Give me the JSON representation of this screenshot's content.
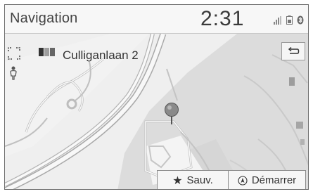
{
  "header": {
    "title": "Navigation",
    "time": "2:31",
    "status_icons": [
      "signal-icon",
      "battery-icon",
      "bluetooth-icon"
    ]
  },
  "map": {
    "address": "Culliganlaan 2",
    "icons": [
      "expand-icon",
      "flag-icon",
      "back-icon",
      "person-icon",
      "location-pin-icon"
    ]
  },
  "actions": {
    "save_label": "Sauv.",
    "start_label": "Démarrer"
  }
}
